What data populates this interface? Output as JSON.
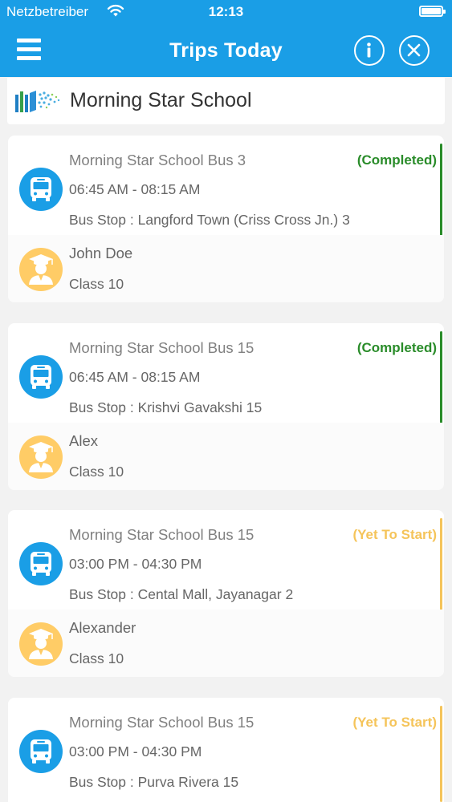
{
  "status_bar": {
    "carrier": "Netzbetreiber",
    "time": "12:13"
  },
  "nav": {
    "title": "Trips Today"
  },
  "school": {
    "name": "Morning Star School"
  },
  "colors": {
    "primary": "#1a9ee6",
    "completed": "#2a8c2a",
    "pending": "#f5c45a",
    "student": "#ffcc66"
  },
  "trips": [
    {
      "bus": "Morning Star School Bus 3",
      "status": "(Completed)",
      "time": "06:45 AM - 08:15 AM",
      "stop": "Bus Stop : Langford Town (Criss Cross Jn.) 3",
      "student": "John Doe",
      "class": "Class 10"
    },
    {
      "bus": "Morning Star School Bus 15",
      "status": "(Completed)",
      "time": "06:45 AM - 08:15 AM",
      "stop": "Bus Stop : Krishvi Gavakshi 15",
      "student": "Alex",
      "class": "Class 10"
    },
    {
      "bus": "Morning Star School Bus 15",
      "status": "(Yet To Start)",
      "time": "03:00 PM - 04:30 PM",
      "stop": "Bus Stop : Cental Mall, Jayanagar 2",
      "student": "Alexander",
      "class": "Class 10"
    },
    {
      "bus": "Morning Star School Bus 15",
      "status": "(Yet To Start)",
      "time": "03:00 PM - 04:30 PM",
      "stop": "Bus Stop : Purva Rivera 15",
      "student": "",
      "class": ""
    }
  ]
}
